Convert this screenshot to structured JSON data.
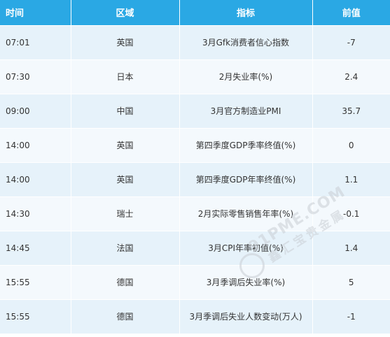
{
  "header": {
    "time": "时间",
    "region": "区域",
    "indicator": "指标",
    "previous": "前值"
  },
  "rows": [
    {
      "time": "07:01",
      "region": "英国",
      "indicator": "3月Gfk消费者信心指数",
      "previous": "-7"
    },
    {
      "time": "07:30",
      "region": "日本",
      "indicator": "2月失业率(%)",
      "previous": "2.4"
    },
    {
      "time": "09:00",
      "region": "中国",
      "indicator": "3月官方制造业PMI",
      "previous": "35.7"
    },
    {
      "time": "14:00",
      "region": "英国",
      "indicator": "第四季度GDP季率终值(%)",
      "previous": "0"
    },
    {
      "time": "14:00",
      "region": "英国",
      "indicator": "第四季度GDP年率终值(%)",
      "previous": "1.1"
    },
    {
      "time": "14:30",
      "region": "瑞士",
      "indicator": "2月实际零售销售年率(%)",
      "previous": "-0.1"
    },
    {
      "time": "14:45",
      "region": "法国",
      "indicator": "3月CPI年率初值(%)",
      "previous": "1.4"
    },
    {
      "time": "15:55",
      "region": "德国",
      "indicator": "3月季调后失业率(%)",
      "previous": "5"
    },
    {
      "time": "15:55",
      "region": "德国",
      "indicator": "3月季调后失业人数变动(万人)",
      "previous": "-1"
    }
  ],
  "watermark": {
    "line1": "91PME.COM",
    "line2": "鑫汇宝贵金属"
  },
  "colors": {
    "header_bg": "#2aa8e4",
    "row_odd": "#e6f2fa",
    "row_even": "#f4f9fd"
  }
}
